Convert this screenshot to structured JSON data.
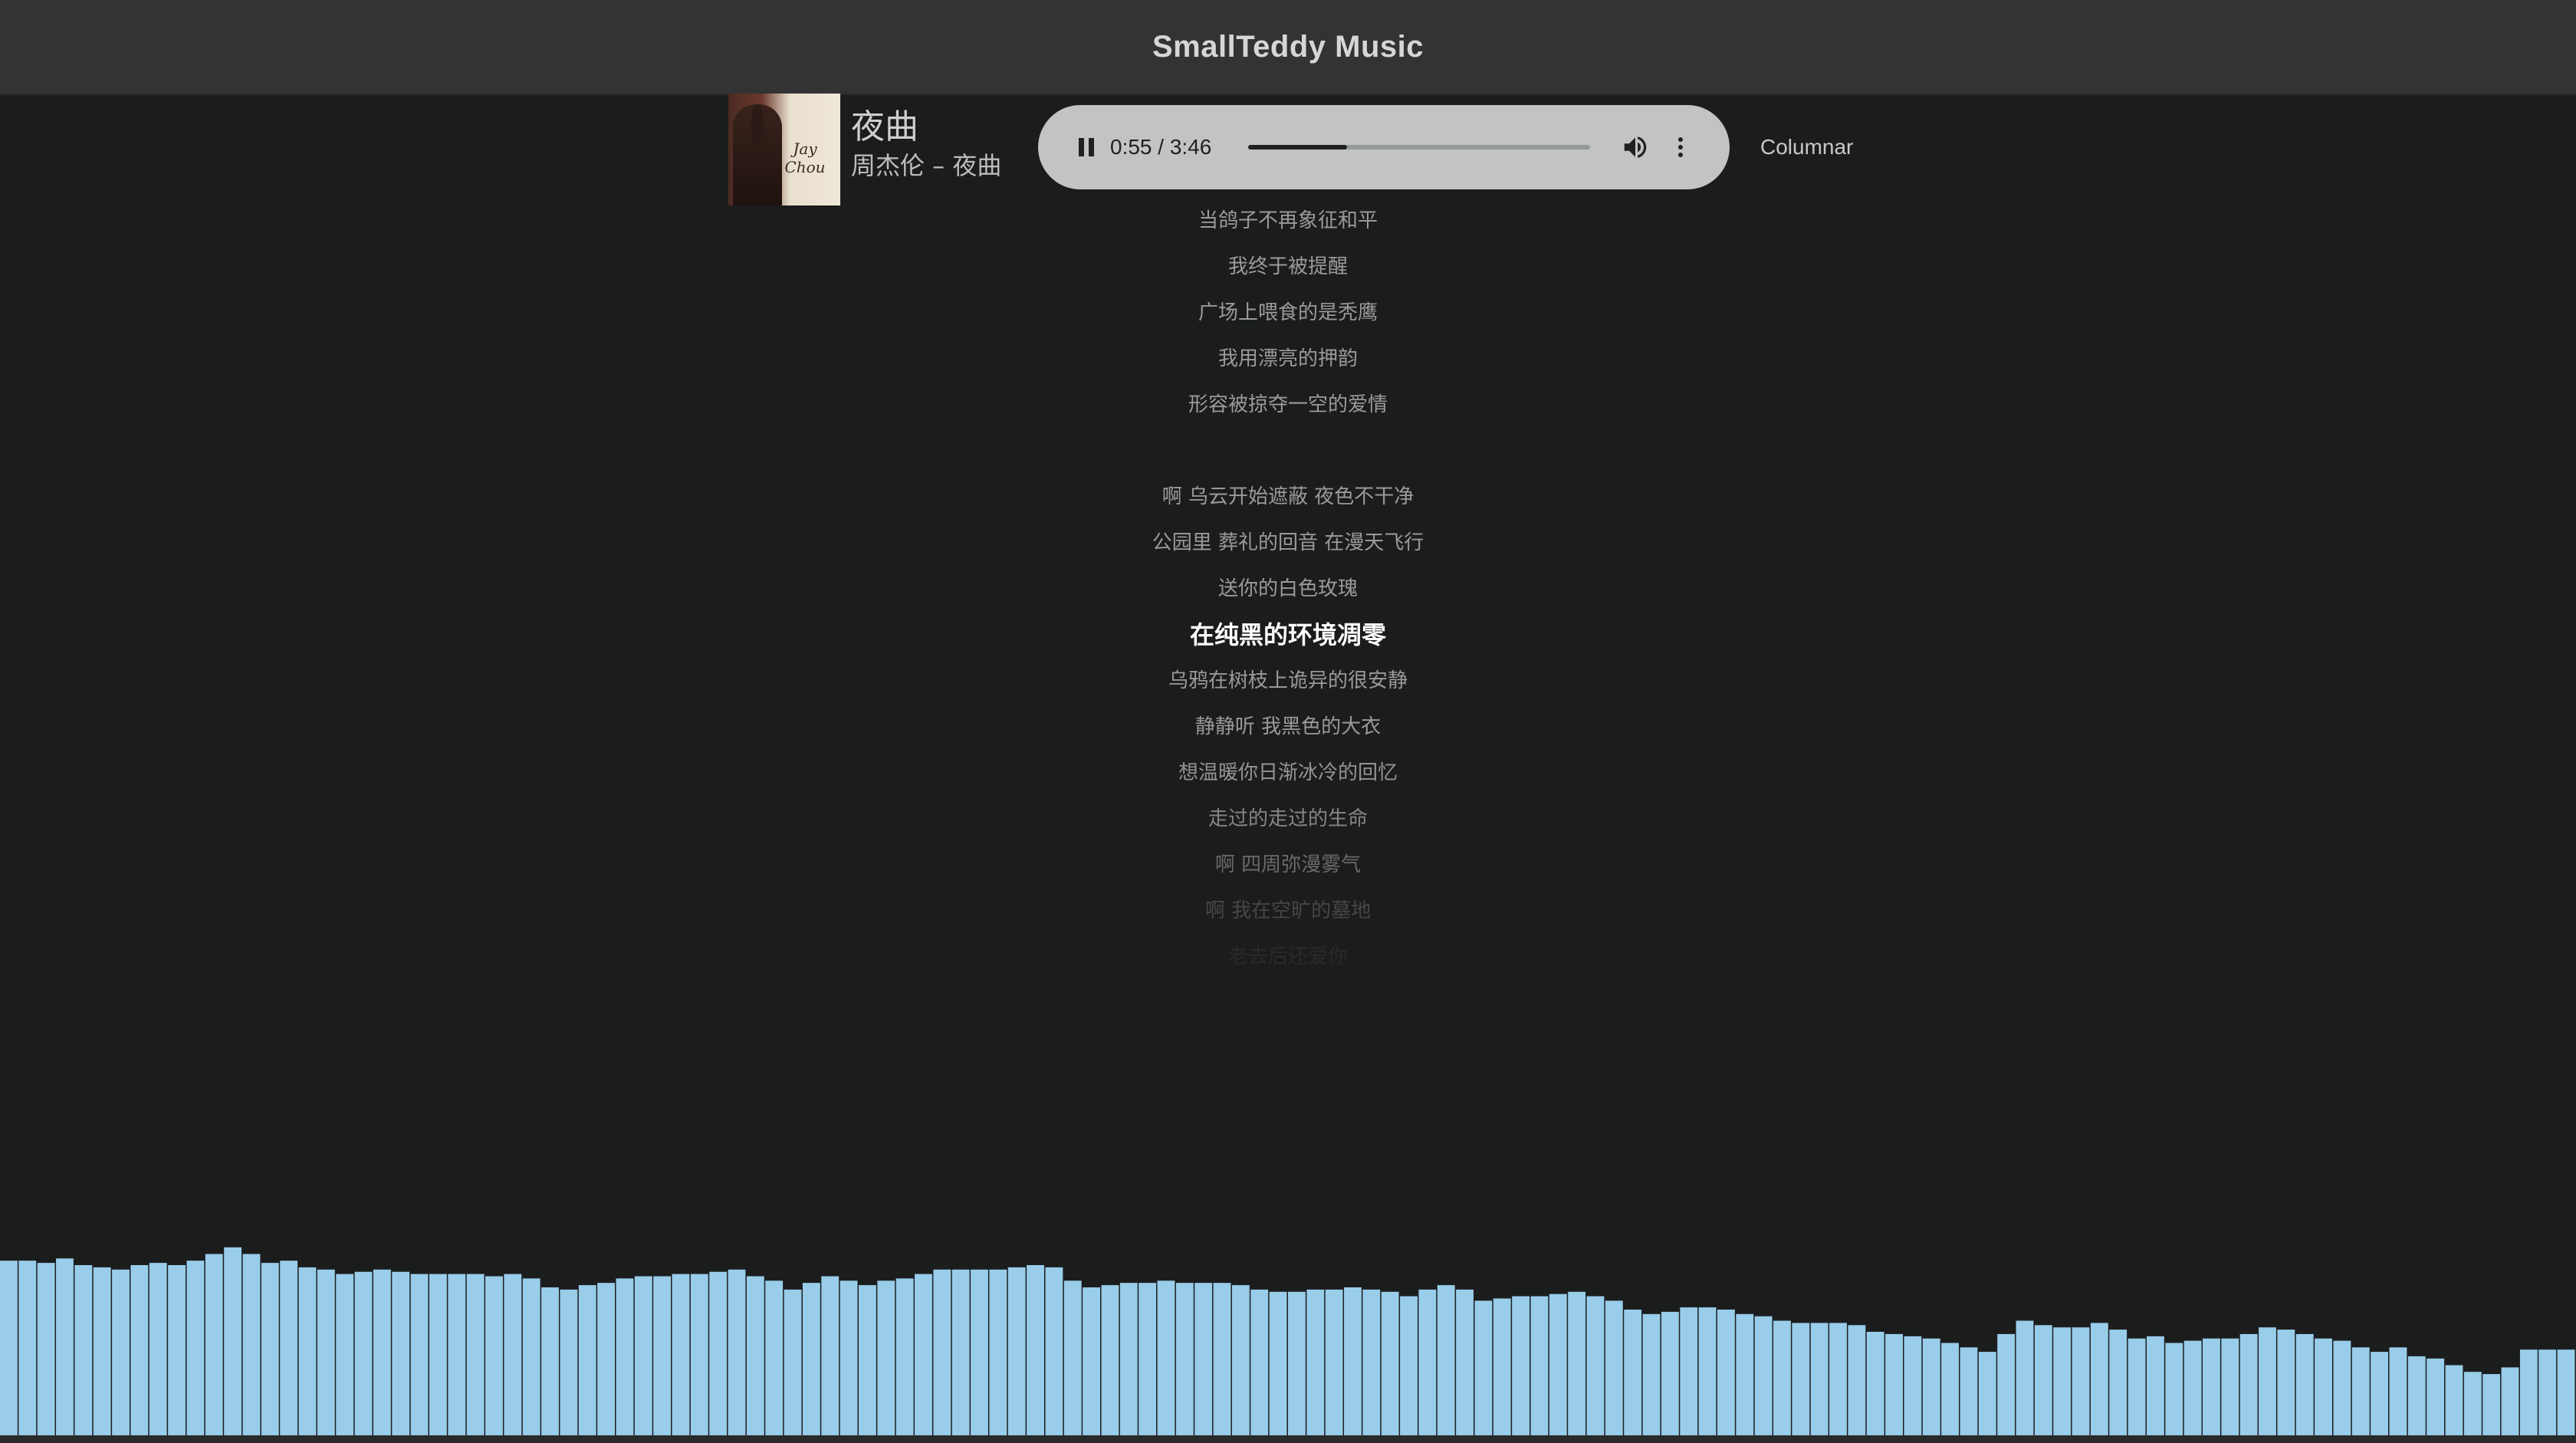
{
  "app": {
    "title": "SmallTeddy Music"
  },
  "track": {
    "title": "夜曲",
    "subtitle": "周杰伦 – 夜曲",
    "cover_text": "Jay Chou"
  },
  "player": {
    "time": "0:55 / 3:46",
    "progress_fraction": 0.29,
    "state": "playing"
  },
  "mode": {
    "label": "Columnar"
  },
  "lyrics": {
    "lines": [
      {
        "text": "当鸽子不再象征和平",
        "opacity": 0.9
      },
      {
        "text": "我终于被提醒",
        "opacity": 0.9
      },
      {
        "text": "广场上喂食的是秃鹰",
        "opacity": 0.9
      },
      {
        "text": "我用漂亮的押韵",
        "opacity": 0.9
      },
      {
        "text": "形容被掠夺一空的爱情",
        "opacity": 0.9
      },
      {
        "text": "",
        "opacity": 0.9
      },
      {
        "text": "啊 乌云开始遮蔽 夜色不干净",
        "opacity": 0.9
      },
      {
        "text": "公园里 葬礼的回音 在漫天飞行",
        "opacity": 0.9
      },
      {
        "text": "送你的白色玫瑰",
        "opacity": 0.9
      },
      {
        "text": "在纯黑的环境凋零",
        "opacity": 1,
        "current": true
      },
      {
        "text": "乌鸦在树枝上诡异的很安静",
        "opacity": 0.9
      },
      {
        "text": "静静听 我黑色的大衣",
        "opacity": 0.9
      },
      {
        "text": "想温暖你日渐冰冷的回忆",
        "opacity": 0.85
      },
      {
        "text": "走过的走过的生命",
        "opacity": 0.75
      },
      {
        "text": "啊 四周弥漫雾气",
        "opacity": 0.55
      },
      {
        "text": "啊 我在空旷的墓地",
        "opacity": 0.3
      },
      {
        "text": "老去后还爱你",
        "opacity": 0.1
      }
    ]
  },
  "visualizer": {
    "color": "#99cdea",
    "levels": [
      0.82,
      0.82,
      0.81,
      0.83,
      0.8,
      0.79,
      0.78,
      0.8,
      0.81,
      0.8,
      0.82,
      0.85,
      0.88,
      0.85,
      0.81,
      0.82,
      0.79,
      0.78,
      0.76,
      0.77,
      0.78,
      0.77,
      0.76,
      0.76,
      0.76,
      0.76,
      0.75,
      0.76,
      0.74,
      0.7,
      0.69,
      0.71,
      0.72,
      0.74,
      0.75,
      0.75,
      0.76,
      0.76,
      0.77,
      0.78,
      0.75,
      0.73,
      0.69,
      0.72,
      0.75,
      0.73,
      0.71,
      0.73,
      0.74,
      0.76,
      0.78,
      0.78,
      0.78,
      0.78,
      0.79,
      0.8,
      0.79,
      0.73,
      0.7,
      0.71,
      0.72,
      0.72,
      0.73,
      0.72,
      0.72,
      0.72,
      0.71,
      0.69,
      0.68,
      0.68,
      0.69,
      0.69,
      0.7,
      0.69,
      0.68,
      0.66,
      0.69,
      0.71,
      0.69,
      0.64,
      0.65,
      0.66,
      0.66,
      0.67,
      0.68,
      0.66,
      0.64,
      0.6,
      0.58,
      0.59,
      0.61,
      0.61,
      0.6,
      0.58,
      0.57,
      0.55,
      0.54,
      0.54,
      0.54,
      0.53,
      0.5,
      0.49,
      0.48,
      0.47,
      0.45,
      0.43,
      0.41,
      0.49,
      0.55,
      0.53,
      0.52,
      0.52,
      0.54,
      0.51,
      0.47,
      0.48,
      0.45,
      0.46,
      0.47,
      0.47,
      0.49,
      0.52,
      0.51,
      0.49,
      0.47,
      0.46,
      0.43,
      0.41,
      0.43,
      0.39,
      0.38,
      0.35,
      0.32,
      0.31,
      0.34,
      0.42,
      0.42,
      0.42
    ]
  }
}
